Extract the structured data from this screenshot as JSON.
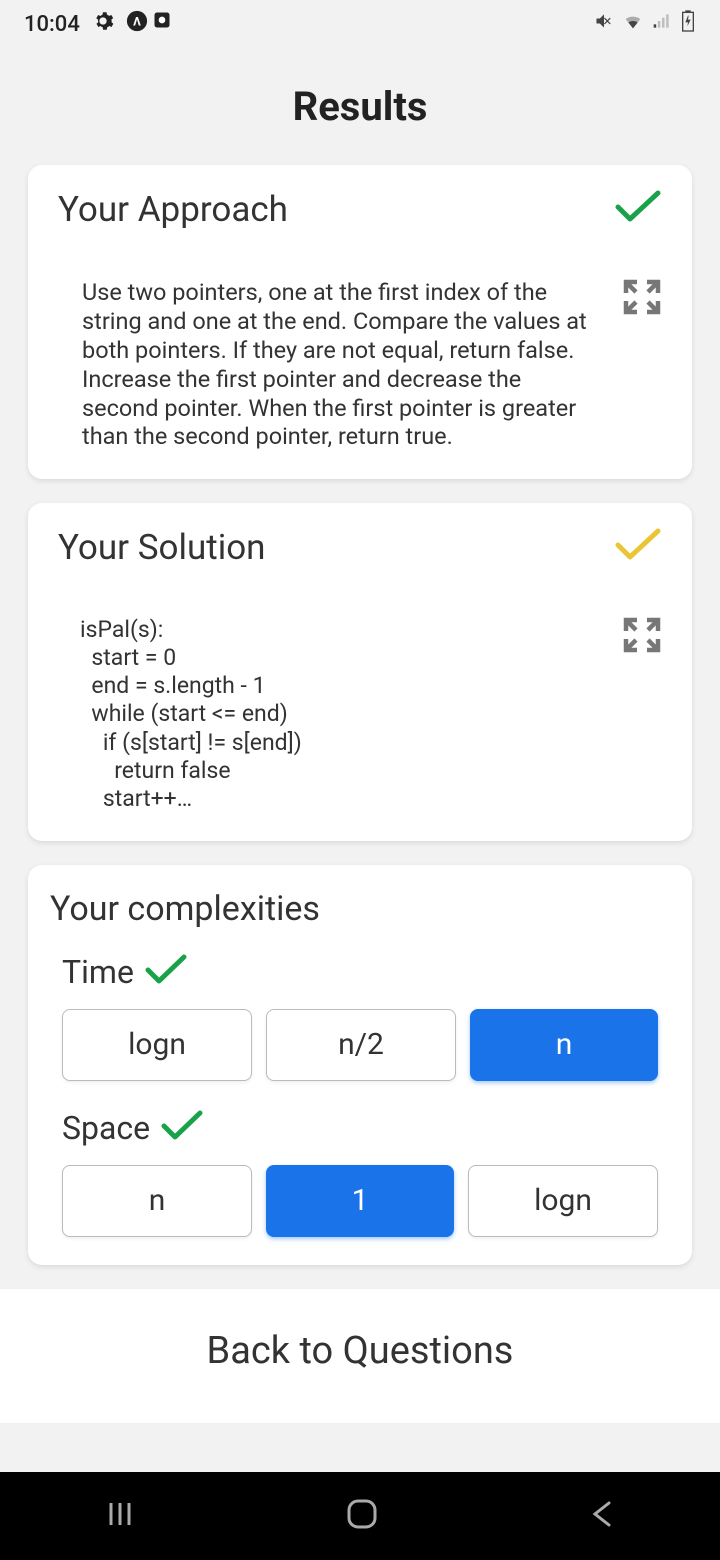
{
  "status": {
    "time": "10:04"
  },
  "page_title": "Results",
  "approach": {
    "title": "Your Approach",
    "text": "Use two pointers, one at the first index of the string and one at the end. Compare the values at both pointers. If they are not equal, return false.  Increase the first pointer and decrease the second pointer.  When the first pointer is greater than the second pointer, return true.",
    "check_color": "#1aa24b"
  },
  "solution": {
    "title": "Your Solution",
    "code": "isPal(s):\n  start = 0\n  end = s.length - 1\n  while (start <= end)\n    if (s[start] != s[end])\n      return false\n    start++…",
    "check_color": "#e8c636"
  },
  "complexities": {
    "title": "Your complexities",
    "time": {
      "label": "Time",
      "options": [
        "logn",
        "n/2",
        "n"
      ],
      "selected_index": 2,
      "correct": true
    },
    "space": {
      "label": "Space",
      "options": [
        "n",
        "1",
        "logn"
      ],
      "selected_index": 1,
      "correct": true
    }
  },
  "back": {
    "label": "Back to Questions"
  }
}
